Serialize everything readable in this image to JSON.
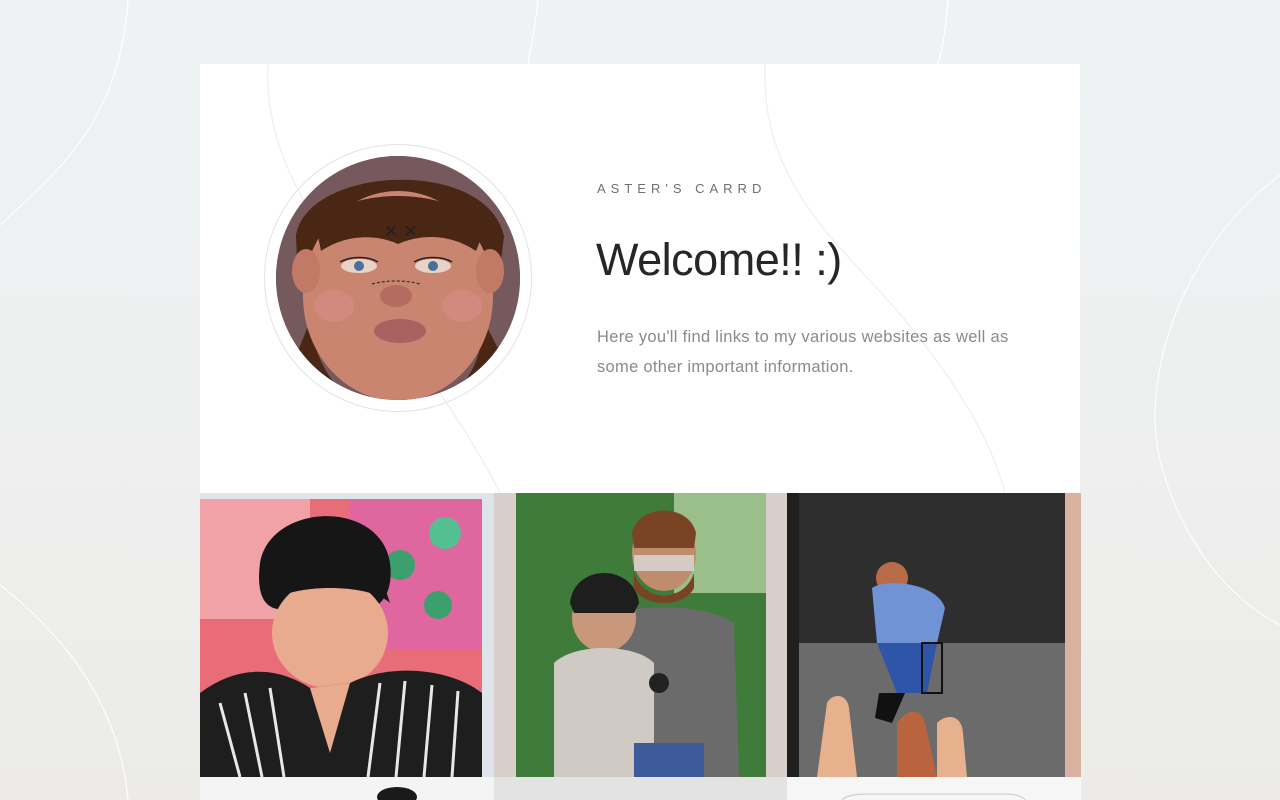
{
  "header": {
    "eyebrow": "ASTER'S CARRD",
    "title": "Welcome!! :)",
    "description": "Here you'll find links to my various websites as well as some other important information."
  },
  "colors": {
    "background": "#eef1f2",
    "card": "#ffffff",
    "title": "#262626",
    "eyebrow": "#6f6f6f",
    "description": "#8a8a8a"
  },
  "avatar": {
    "alt": "painted self-portrait avatar"
  },
  "gallery": {
    "items": [
      {
        "name": "painting-portrait-pink"
      },
      {
        "name": "painting-couple-green"
      },
      {
        "name": "painting-figure-dark"
      }
    ]
  }
}
